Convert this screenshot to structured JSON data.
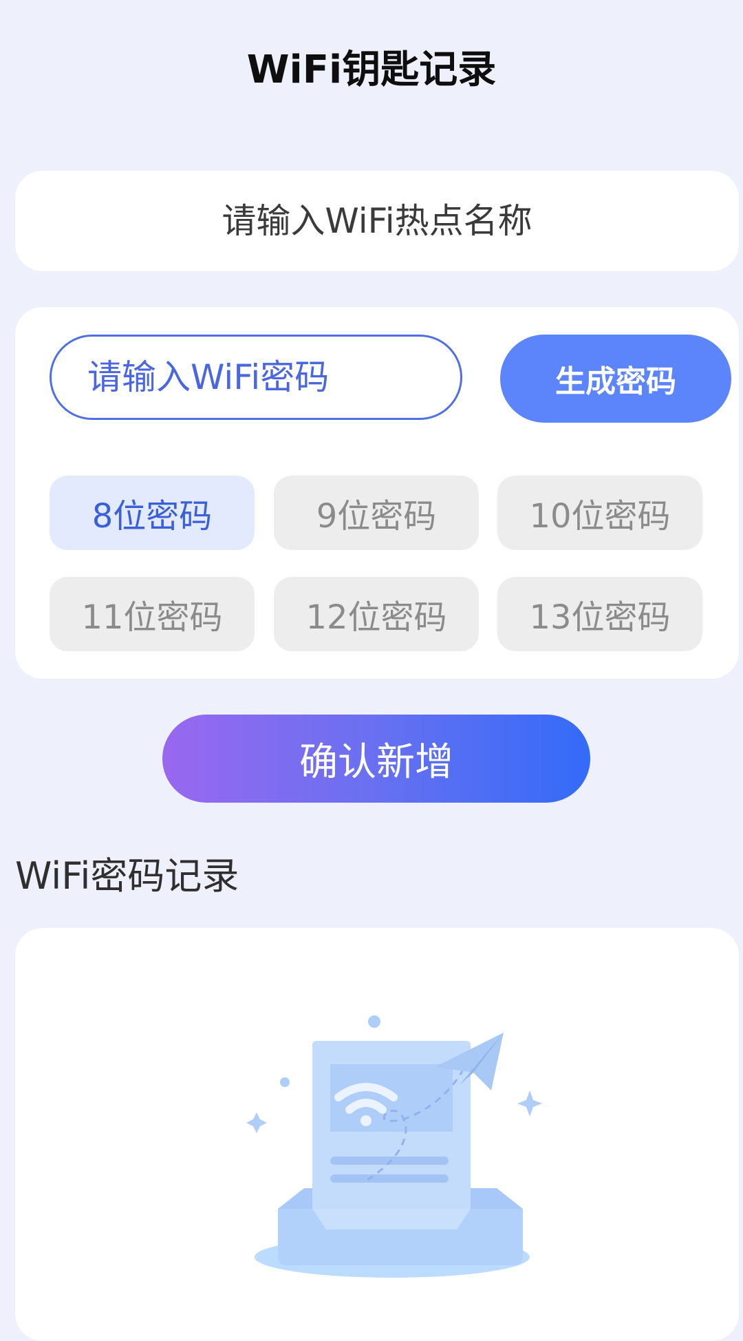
{
  "header": {
    "title": "WiFi钥匙记录"
  },
  "hotspot": {
    "placeholder": "请输入WiFi热点名称"
  },
  "password": {
    "placeholder": "请输入WiFi密码",
    "generate_label": "生成密码",
    "length_options": [
      {
        "label": "8位密码",
        "selected": true
      },
      {
        "label": "9位密码",
        "selected": false
      },
      {
        "label": "10位密码",
        "selected": false
      },
      {
        "label": "11位密码",
        "selected": false
      },
      {
        "label": "12位密码",
        "selected": false
      },
      {
        "label": "13位密码",
        "selected": false
      }
    ]
  },
  "confirm": {
    "label": "确认新增"
  },
  "records": {
    "title": "WiFi密码记录",
    "empty_icon": "empty-inbox-wifi-illustration"
  },
  "colors": {
    "background": "#eef0fc",
    "accent": "#5c85fb",
    "selected_chip_bg": "#e4eafd",
    "selected_chip_text": "#3a60d8",
    "chip_bg": "#ededed",
    "gradient_start": "#9968ef",
    "gradient_end": "#336bf8"
  }
}
